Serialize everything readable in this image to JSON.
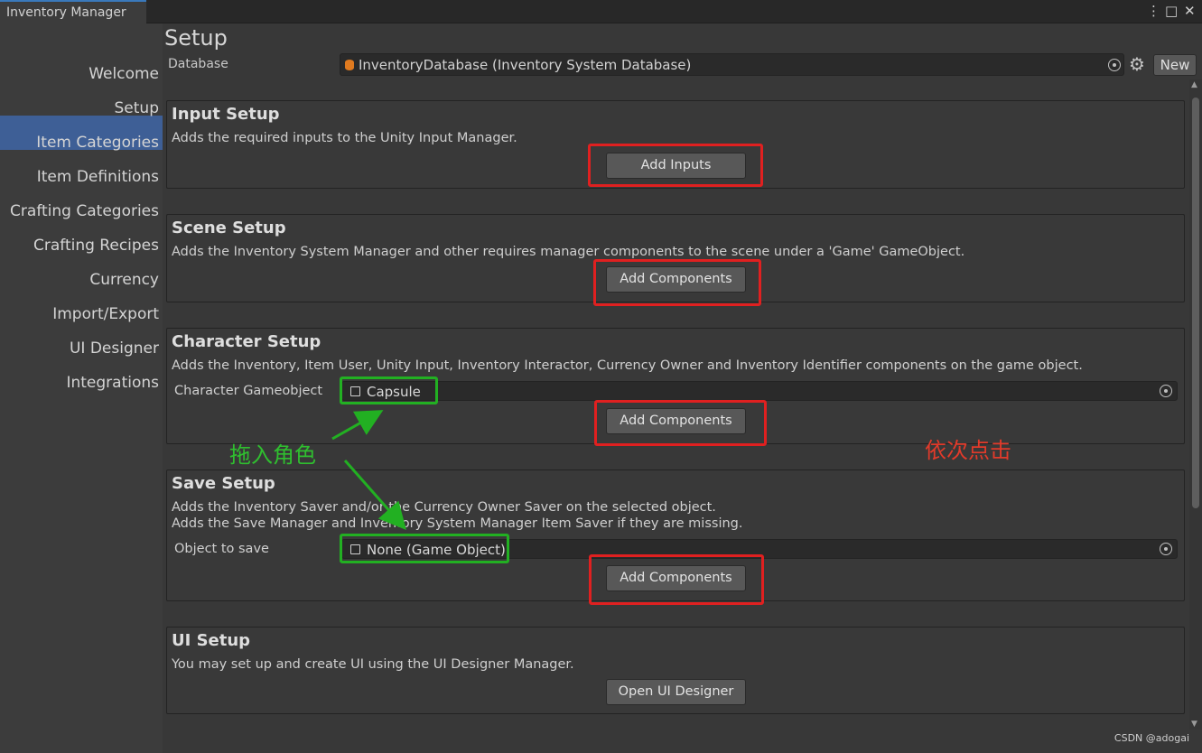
{
  "window": {
    "tab_title": "Inventory Manager",
    "menu_icon": "⋮",
    "maximize_icon": "□",
    "close_icon": "✕"
  },
  "sidebar": {
    "items": [
      {
        "label": "Welcome"
      },
      {
        "label": "Setup"
      },
      {
        "label": "Item Categories"
      },
      {
        "label": "Item Definitions"
      },
      {
        "label": "Crafting Categories"
      },
      {
        "label": "Crafting Recipes"
      },
      {
        "label": "Currency"
      },
      {
        "label": "Import/Export"
      },
      {
        "label": "UI Designer"
      },
      {
        "label": "Integrations"
      }
    ],
    "selected": "Setup"
  },
  "header": {
    "title": "Setup",
    "database_label": "Database",
    "database_value": "InventoryDatabase (Inventory System Database)",
    "new_button": "New"
  },
  "sections": {
    "input": {
      "title": "Input Setup",
      "description": "Adds the required inputs to the Unity Input Manager.",
      "button": "Add Inputs"
    },
    "scene": {
      "title": "Scene Setup",
      "description": "Adds the Inventory System Manager and other requires manager components to the scene under a 'Game' GameObject.",
      "button": "Add Components"
    },
    "character": {
      "title": "Character Setup",
      "description": "Adds the Inventory, Item User, Unity Input, Inventory Interactor, Currency Owner and Inventory Identifier components on the game object.",
      "field_label": "Character Gameobject",
      "field_value": "Capsule",
      "button": "Add Components"
    },
    "save": {
      "title": "Save Setup",
      "description_1": "Adds the Inventory Saver and/or the Currency Owner Saver on the selected object.",
      "description_2": "Adds the Save Manager and Inventory System Manager Item Saver if they are missing.",
      "field_label": "Object to save",
      "field_value": "None (Game Object)",
      "button": "Add Components"
    },
    "ui": {
      "title": "UI Setup",
      "description": "You may set up and create UI using the UI Designer Manager.",
      "button": "Open UI Designer"
    }
  },
  "annotations": {
    "drag_in": "拖入角色",
    "click_in_order": "依次点击",
    "annotation_colors": {
      "red": "#e02020",
      "green": "#22b022"
    }
  },
  "watermark": "CSDN @adogai",
  "colors": {
    "background": "#383838",
    "sidebar_bg": "#3c3c3c",
    "selected_bg": "#3e5f96",
    "button_bg": "#585858"
  }
}
